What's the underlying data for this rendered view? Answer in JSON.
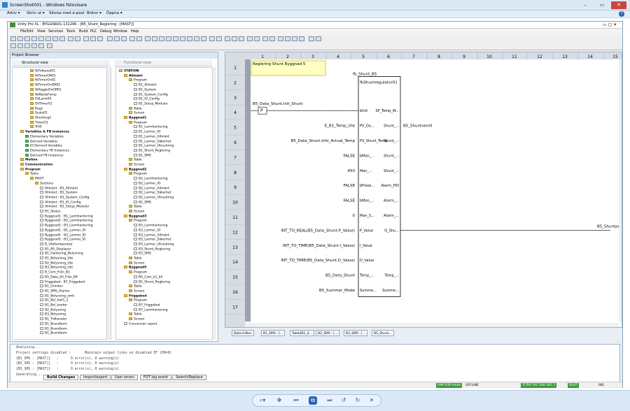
{
  "photoviewer": {
    "title": "ScreenShot001 - Windows fotovisare",
    "help": "?",
    "menu": [
      "Arkiv ▾",
      "Skriv ut ▾",
      "Skicka med e-post",
      "Bränn ▾",
      "Öppna ▾"
    ],
    "window_controls": [
      "–",
      "▭",
      "✕"
    ]
  },
  "unity": {
    "title": "Unity Pro XL : BYGGNAD1-131206 - [B5_Shunt_Reglering : [MAST]]",
    "menu": [
      "File",
      "Edit",
      "View",
      "Services",
      "Tools",
      "Build",
      "PLC",
      "Debug",
      "Window",
      "Help"
    ]
  },
  "browser": {
    "title": "Project Browser",
    "structural_tab": "Structural view",
    "functional_tab": "Functional view",
    "structural": [
      {
        "t": "fbTidkanal01",
        "i": "f",
        "l": 3
      },
      {
        "t": "fbTimerOff01",
        "i": "f",
        "l": 3
      },
      {
        "t": "fbTimerOn01",
        "i": "f",
        "l": 3
      },
      {
        "t": "fbTimerOnOff01",
        "i": "f",
        "l": 3
      },
      {
        "t": "fbToggleOnOff01",
        "i": "f",
        "l": 3
      },
      {
        "t": "fbWasteFump",
        "i": "f",
        "l": 3
      },
      {
        "t": "OilLarm04",
        "i": "f",
        "l": 3
      },
      {
        "t": "OilTimer01",
        "i": "f",
        "l": 3
      },
      {
        "t": "Reg1",
        "i": "f",
        "l": 3
      },
      {
        "t": "Scale01",
        "i": "f",
        "l": 3
      },
      {
        "t": "Shuntreg1",
        "i": "f",
        "l": 3
      },
      {
        "t": "Timer01",
        "i": "f",
        "l": 3
      },
      {
        "t": "Tr00",
        "i": "f",
        "l": 3
      },
      {
        "t": "Variables & FB instances",
        "i": "f",
        "l": 1,
        "b": true
      },
      {
        "t": "Elementary Variables",
        "i": "g",
        "l": 2
      },
      {
        "t": "Derived Variables",
        "i": "g",
        "l": 2
      },
      {
        "t": "IO Derived Variables",
        "i": "g",
        "l": 2
      },
      {
        "t": "Elementary FB Instances",
        "i": "g",
        "l": 2
      },
      {
        "t": "Derived FB Instances",
        "i": "g",
        "l": 2
      },
      {
        "t": "Motion",
        "i": "f",
        "l": 1,
        "b": true
      },
      {
        "t": "Communication",
        "i": "f",
        "l": 1,
        "b": true
      },
      {
        "t": "Program",
        "i": "f",
        "l": 1,
        "b": true
      },
      {
        "t": "Tasks",
        "i": "f",
        "l": 2
      },
      {
        "t": "MAST",
        "i": "f",
        "l": 3
      },
      {
        "t": "Sections",
        "i": "f",
        "l": 4,
        "sel": true
      },
      {
        "t": "Allmänt : B1_Allmänt",
        "i": "d",
        "l": 5
      },
      {
        "t": "Allmänt : B1_System",
        "i": "d",
        "l": 5
      },
      {
        "t": "Allmänt : B1_System_Config",
        "i": "d",
        "l": 5
      },
      {
        "t": "Allmänt : B1_IO_Config",
        "i": "d",
        "l": 5
      },
      {
        "t": "Allmänt : B1_Setup_Moduler",
        "i": "d",
        "l": 5
      },
      {
        "t": "B1_Status",
        "i": "d",
        "l": 5
      },
      {
        "t": "Byggnad1 : B1_Larmhantering",
        "i": "d",
        "l": 5
      },
      {
        "t": "Byggnad2 : B2_Larmhantering",
        "i": "d",
        "l": 5
      },
      {
        "t": "Byggnad3 : B3_Larmhantering",
        "i": "d",
        "l": 5
      },
      {
        "t": "Byggnad1 : B1_Larmer_IO",
        "i": "d",
        "l": 5
      },
      {
        "t": "Byggnad2 : B2_Larmer_IO",
        "i": "d",
        "l": 5
      },
      {
        "t": "Byggnad3 : B3_Larmer_IO",
        "i": "d",
        "l": 5
      },
      {
        "t": "B_Uteltemperatur",
        "i": "d",
        "l": 5
      },
      {
        "t": "B1_B5_Displayer",
        "i": "d",
        "l": 5
      },
      {
        "t": "B1_Hantering_Belysning",
        "i": "d",
        "l": 5
      },
      {
        "t": "B1_Belysning_Ute",
        "i": "d",
        "l": 5
      },
      {
        "t": "B2_Belysning_Ute",
        "i": "d",
        "l": 5
      },
      {
        "t": "B3_Belysning_Ute",
        "i": "d",
        "l": 5
      },
      {
        "t": "B_Com_Från_B1",
        "i": "d",
        "l": 5
      },
      {
        "t": "B5_Data_till_Från_B4",
        "i": "d",
        "l": 5
      },
      {
        "t": "Friggebod : B7_Friggebod",
        "i": "d",
        "l": 5
      },
      {
        "t": "B1_Grinden",
        "i": "d",
        "l": 5
      },
      {
        "t": "B1_SMS_Alarms",
        "i": "d",
        "l": 5
      },
      {
        "t": "B1_Belysning_omk",
        "i": "d",
        "l": 5
      },
      {
        "t": "B1_Bel_hall1_2",
        "i": "d",
        "l": 5
      },
      {
        "t": "B1_Bel_kontor",
        "i": "d",
        "l": 5
      },
      {
        "t": "B2_Belysning",
        "i": "d",
        "l": 5
      },
      {
        "t": "B3_Belysning",
        "i": "d",
        "l": 5
      },
      {
        "t": "B1_Tidkanaler",
        "i": "d",
        "l": 5
      },
      {
        "t": "B1_Brandlarm",
        "i": "d",
        "l": 5
      },
      {
        "t": "B1_Brandlarm",
        "i": "d",
        "l": 5
      },
      {
        "t": "B1_Brandlarm",
        "i": "d",
        "l": 5
      }
    ],
    "functional": [
      {
        "t": "STATION",
        "i": "f",
        "l": 0,
        "b": true
      },
      {
        "t": "Allmänt",
        "i": "f",
        "l": 1,
        "b": true
      },
      {
        "t": "Program",
        "i": "f",
        "l": 2
      },
      {
        "t": "B1_Allmänt",
        "i": "d",
        "l": 3
      },
      {
        "t": "B1_System",
        "i": "d",
        "l": 3
      },
      {
        "t": "B1_System_Config",
        "i": "d",
        "l": 3
      },
      {
        "t": "B1_IO_Config",
        "i": "d",
        "l": 3
      },
      {
        "t": "B1_Setup_Moduler",
        "i": "d",
        "l": 3
      },
      {
        "t": "Table",
        "i": "f",
        "l": 2
      },
      {
        "t": "Screen",
        "i": "f",
        "l": 2
      },
      {
        "t": "Byggnad1",
        "i": "f",
        "l": 1,
        "b": true
      },
      {
        "t": "Program",
        "i": "f",
        "l": 2
      },
      {
        "t": "B1_Larmhantering",
        "i": "d",
        "l": 3
      },
      {
        "t": "B1_Larmer_IO",
        "i": "d",
        "l": 3
      },
      {
        "t": "B1_Larmer_Allmänt",
        "i": "d",
        "l": 3
      },
      {
        "t": "B1_Larmer_Säkerhet",
        "i": "d",
        "l": 3
      },
      {
        "t": "B1_Larmer_Utrustning",
        "i": "d",
        "l": 3
      },
      {
        "t": "B1_Shunt_Reglering",
        "i": "d",
        "l": 3
      },
      {
        "t": "B1_SMS",
        "i": "d",
        "l": 3
      },
      {
        "t": "Table",
        "i": "f",
        "l": 2
      },
      {
        "t": "Screen",
        "i": "f",
        "l": 2
      },
      {
        "t": "Byggnad2",
        "i": "f",
        "l": 1,
        "b": true
      },
      {
        "t": "Program",
        "i": "f",
        "l": 2
      },
      {
        "t": "B2_Larmhantering",
        "i": "d",
        "l": 3
      },
      {
        "t": "B2_Larmer_IO",
        "i": "d",
        "l": 3
      },
      {
        "t": "B2_Larmer_Allmänt",
        "i": "d",
        "l": 3
      },
      {
        "t": "B2_Larmer_Säkerhet",
        "i": "d",
        "l": 3
      },
      {
        "t": "B2_Larmer_Utrustning",
        "i": "d",
        "l": 3
      },
      {
        "t": "B2_SMS",
        "i": "d",
        "l": 3
      },
      {
        "t": "Table",
        "i": "f",
        "l": 2
      },
      {
        "t": "Screen",
        "i": "f",
        "l": 2
      },
      {
        "t": "Byggnad3",
        "i": "f",
        "l": 1,
        "b": true
      },
      {
        "t": "Program",
        "i": "f",
        "l": 2
      },
      {
        "t": "B3_Larmhantering",
        "i": "d",
        "l": 3
      },
      {
        "t": "B3_Larmer_IO",
        "i": "d",
        "l": 3
      },
      {
        "t": "B3_Larmer_Allmänt",
        "i": "d",
        "l": 3
      },
      {
        "t": "B3_Larmer_Säkerhet",
        "i": "d",
        "l": 3
      },
      {
        "t": "B3_Larmer_Utrustning",
        "i": "d",
        "l": 3
      },
      {
        "t": "B3_Shunt_Reglering",
        "i": "d",
        "l": 3
      },
      {
        "t": "B3_SMS",
        "i": "d",
        "l": 3
      },
      {
        "t": "Table",
        "i": "f",
        "l": 2
      },
      {
        "t": "Screen",
        "i": "f",
        "l": 2
      },
      {
        "t": "Byggnad5",
        "i": "f",
        "l": 1,
        "b": true
      },
      {
        "t": "Program",
        "i": "f",
        "l": 2
      },
      {
        "t": "B5_Com_b1_b5",
        "i": "d",
        "l": 3
      },
      {
        "t": "B5_Shunt_Reglering",
        "i": "d",
        "l": 3
      },
      {
        "t": "Table",
        "i": "f",
        "l": 2
      },
      {
        "t": "Screen",
        "i": "f",
        "l": 2
      },
      {
        "t": "Friggebod",
        "i": "f",
        "l": 1,
        "b": true
      },
      {
        "t": "Program",
        "i": "f",
        "l": 2
      },
      {
        "t": "B7_Friggebod",
        "i": "d",
        "l": 3
      },
      {
        "t": "B7_Larmhantering",
        "i": "d",
        "l": 3
      },
      {
        "t": "Table",
        "i": "f",
        "l": 2
      },
      {
        "t": "Screen",
        "i": "f",
        "l": 2
      },
      {
        "t": "Conversion report",
        "i": "d",
        "l": 1
      }
    ]
  },
  "editor": {
    "columns": [
      "1",
      "2",
      "3",
      "4",
      "5",
      "6",
      "7",
      "8",
      "9",
      "10",
      "11",
      "12",
      "13",
      "14",
      "15"
    ],
    "rows": [
      "1",
      "2",
      "3",
      "4",
      "5",
      "6",
      "7",
      "8",
      "9",
      "10",
      "11",
      "12",
      "13",
      "14",
      "15",
      "16",
      "17"
    ],
    "comment": "Reglering Shunt Byggnad 5",
    "instance": "fb_Shunt_B5",
    "type": "fbShuntregulator01",
    "contact": "B5_Data_Shunt.Init_Shunt",
    "inputs": [
      {
        "pin": "bInit",
        "val": ""
      },
      {
        "pin": "PV_Ou...",
        "val": "E_B1_Temp_Ute"
      },
      {
        "pin": "PV_Shunt_Temp",
        "val": "B5_Data_Shunt.Info_Actual_Temp"
      },
      {
        "pin": "bMan_...",
        "val": "FALSE"
      },
      {
        "pin": "Man_...",
        "val": "450"
      },
      {
        "pin": "bFreez...",
        "val": "FALSE"
      },
      {
        "pin": "bMan_...",
        "val": "FALSE"
      },
      {
        "pin": "Man_S...",
        "val": "0"
      },
      {
        "pin": "P_Value",
        "val": "INT_TO_REAL(B5_Data_Shunt.P_Value)"
      },
      {
        "pin": "I_Value",
        "val": "INT_TO_TIME(B5_Data_Shunt.I_Value)"
      },
      {
        "pin": "D_Value",
        "val": "INT_TO_TIME(B5_Data_Shunt.D_Value)"
      },
      {
        "pin": "Temp_...",
        "val": "B5_Data_Shunt"
      },
      {
        "pin": "Summe...",
        "val": "B5_Summer_Mode"
      }
    ],
    "outputs": [
      {
        "pin": "SP_Temp_W...",
        "val": ""
      },
      {
        "pin": "Shunt_...",
        "val": "B5_Shuntventil"
      },
      {
        "pin": "Shunt_...",
        "val": ""
      },
      {
        "pin": "Shunt_...",
        "val": ""
      },
      {
        "pin": "Shunt_...",
        "val": ""
      },
      {
        "pin": "Alarm_PID",
        "val": ""
      },
      {
        "pin": "Alarm_...",
        "val": ""
      },
      {
        "pin": "Alarm_...",
        "val": ""
      },
      {
        "pin": "O_Shu...",
        "val": "B5_Shuntpo"
      },
      {
        "pin": "",
        "val": ""
      },
      {
        "pin": "",
        "val": ""
      },
      {
        "pin": "Temp_...",
        "val": ""
      },
      {
        "pin": "Summe...",
        "val": ""
      }
    ]
  },
  "editor_tabs": [
    "Data Editor",
    "B1_SMS : [...",
    "Table[B1_S...",
    "B2_SMS : [...",
    "B3_SMS : [...",
    "B5_Shunt..."
  ],
  "output": {
    "lines": [
      "Analyzing...",
      "Project settings disabled :       Maintain output links on disabled EF (EN=0)",
      "{B1_SMS : [MAST]}   :      0 error(s), 0 warning(s)",
      "{B2_SMS : [MAST]}   :      0 error(s), 0 warning(s)",
      "{B3_SMS : [MAST]}   :      0 error(s), 0 warning(s)",
      "Generating..."
    ],
    "tabs": [
      "Build Changes",
      "Import/export",
      "User errors",
      "FDT log event",
      "Search/Replace"
    ]
  },
  "status": {
    "mode": "HMI R/W mode",
    "state": "OFFLINE",
    "address": "TCPIP:192.168.182.3",
    "built": "BUILT",
    "ins": "INS"
  },
  "pv_controls": [
    "⌕▾",
    "✥",
    "⏮",
    "⧉",
    "⏭",
    "↺",
    "↻",
    "✕"
  ]
}
